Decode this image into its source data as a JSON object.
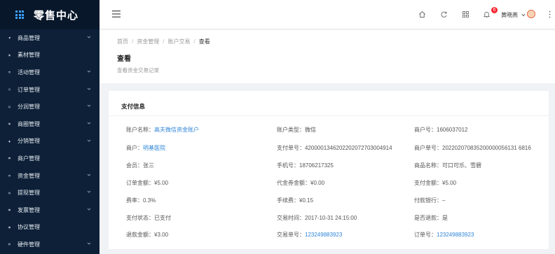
{
  "app": {
    "title": "零售中心"
  },
  "sidebar": {
    "items": [
      {
        "label": "商品管理",
        "icon": "tag-icon",
        "expandable": true
      },
      {
        "label": "素材管理",
        "icon": "file-icon",
        "expandable": false
      },
      {
        "label": "活动管理",
        "icon": "calendar-icon",
        "expandable": true
      },
      {
        "label": "订单管理",
        "icon": "bookmark-icon",
        "expandable": true
      },
      {
        "label": "分润管理",
        "icon": "monitor-icon",
        "expandable": true
      },
      {
        "label": "商圈管理",
        "icon": "apps-icon",
        "expandable": true
      },
      {
        "label": "分销管理",
        "icon": "home-icon",
        "expandable": true
      },
      {
        "label": "商户管理",
        "icon": "id-card-icon",
        "expandable": false
      },
      {
        "label": "资金管理",
        "icon": "calendar-icon",
        "expandable": true
      },
      {
        "label": "提现管理",
        "icon": "wallet-icon",
        "expandable": true
      },
      {
        "label": "发票管理",
        "icon": "invoice-icon",
        "expandable": true
      },
      {
        "label": "协议管理",
        "icon": "contract-icon",
        "expandable": false
      },
      {
        "label": "硬件管理",
        "icon": "device-icon",
        "expandable": true
      }
    ]
  },
  "header": {
    "notification_count": "6",
    "user_name": "黄晓燕"
  },
  "breadcrumb": {
    "items": [
      "首页",
      "资金管理",
      "账户交易"
    ],
    "current": "查看"
  },
  "page": {
    "title": "查看",
    "description": "查看资金交易记录"
  },
  "card": {
    "title": "支付信息",
    "fields": [
      {
        "label": "账户名称：",
        "value": "高夫微信资金账户",
        "link": true
      },
      {
        "label": "账户类型：",
        "value": "微信",
        "link": false
      },
      {
        "label": "商户号：",
        "value": "1606037012",
        "link": false
      },
      {
        "label": "商户：",
        "value": "明基医院",
        "link": true
      },
      {
        "label": "支付单号：",
        "value": "4200001346202202072703004914",
        "link": false
      },
      {
        "label": "商户单号：",
        "value": "202202070835200000056131 6816",
        "link": false
      },
      {
        "label": "会员：",
        "value": "张三",
        "link": false
      },
      {
        "label": "手机号：",
        "value": "18706217325",
        "link": false
      },
      {
        "label": "商品名称：",
        "value": "可口可乐、雪碧",
        "link": false
      },
      {
        "label": "订单金额：",
        "value": "¥5.00",
        "link": false
      },
      {
        "label": "代金券金额：",
        "value": "¥0.00",
        "link": false
      },
      {
        "label": "支付金额：",
        "value": "¥5.00",
        "link": false
      },
      {
        "label": "费率：",
        "value": "0.3%",
        "link": false
      },
      {
        "label": "手续费：",
        "value": "¥0.15",
        "link": false
      },
      {
        "label": "付款银行：",
        "value": "–",
        "link": false
      },
      {
        "label": "支付状态：",
        "value": "已支付",
        "link": false
      },
      {
        "label": "交易时间：",
        "value": "2017-10-31  24:15:00",
        "link": false
      },
      {
        "label": "是否退款：",
        "value": "是",
        "link": false
      },
      {
        "label": "退款金额：",
        "value": "¥3.00",
        "link": false
      },
      {
        "label": "交易单号：",
        "value": "123249883923",
        "link": true
      },
      {
        "label": "订单号：",
        "value": "123249883923",
        "link": true
      }
    ]
  },
  "colors": {
    "sidebar_bg": "#0d2038",
    "logo_bg": "#08172a",
    "accent": "#2f86d8",
    "badge": "#f5222d"
  }
}
